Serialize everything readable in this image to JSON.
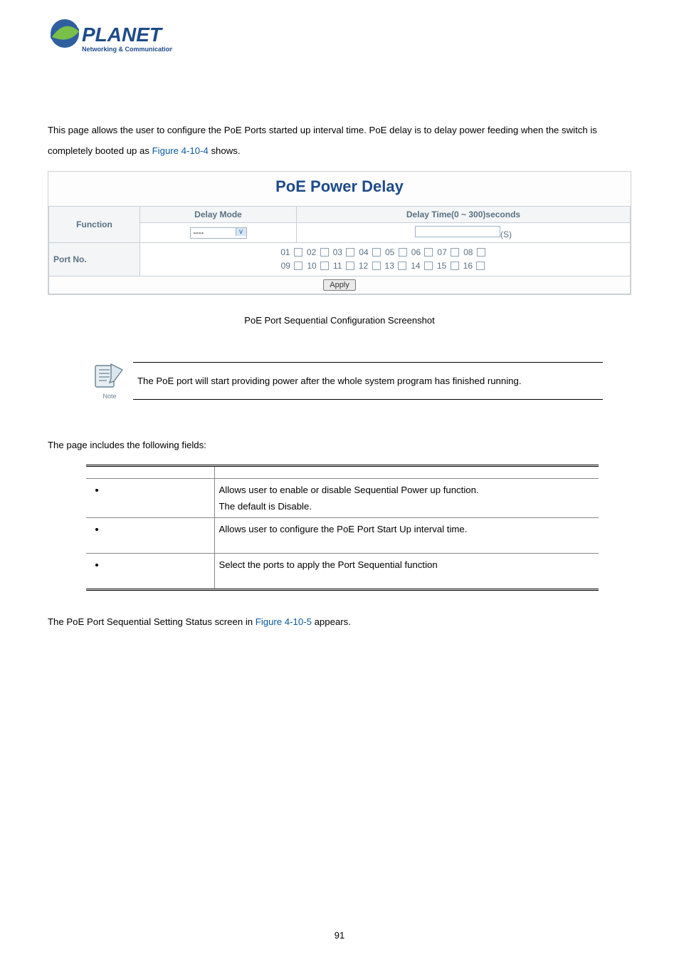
{
  "logo": {
    "brand": "PLANET",
    "tagline": "Networking & Communication"
  },
  "intro": {
    "text_before_link": "This page allows the user to configure the PoE Ports started up interval time. PoE delay is to delay power feeding when the switch is completely booted up as ",
    "figure_link": "Figure 4-10-4",
    "text_after_link": " shows."
  },
  "screenshot": {
    "title": "PoE Power Delay",
    "function_label": "Function",
    "delay_mode_header": "Delay Mode",
    "delay_time_header": "Delay Time(0 ~ 300)seconds",
    "delay_mode_value": "----",
    "delay_time_unit": "(S)",
    "port_no_label": "Port No.",
    "ports_row1": [
      "01",
      "02",
      "03",
      "04",
      "05",
      "06",
      "07",
      "08"
    ],
    "ports_row2": [
      "09",
      "10",
      "11",
      "12",
      "13",
      "14",
      "15",
      "16"
    ],
    "apply_label": "Apply"
  },
  "caption": "PoE Port Sequential Configuration Screenshot",
  "note": {
    "icon_label": "Note",
    "text": "The PoE port will start providing power after the whole system program has finished running."
  },
  "fields_intro": "The page includes the following fields:",
  "fields_table": {
    "rows": [
      {
        "desc_line1": "Allows user to enable or disable Sequential Power up function.",
        "desc_line2": "The default is Disable."
      },
      {
        "desc_line1": "Allows user to configure the PoE Port Start Up interval time.",
        "desc_line2": ""
      },
      {
        "desc_line1": "Select the ports to apply the Port Sequential function",
        "desc_line2": ""
      }
    ]
  },
  "status_line": {
    "before": "The PoE Port Sequential Setting Status screen in ",
    "figure_link": "Figure 4-10-5",
    "after": " appears."
  },
  "page_number": "91"
}
